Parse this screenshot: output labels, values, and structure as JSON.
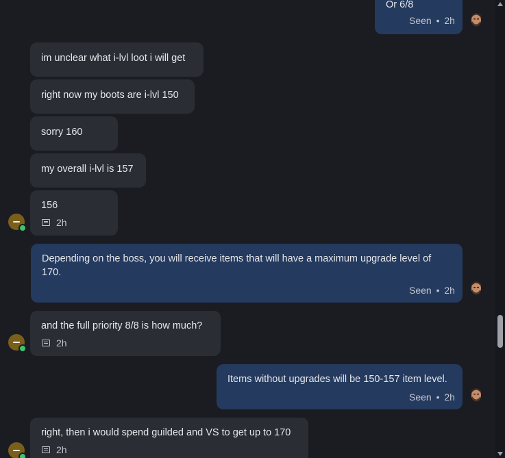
{
  "messages": [
    {
      "text": "Or 6/8",
      "seen": "Seen",
      "time": "2h"
    },
    {
      "text": "im unclear what i-lvl loot i will get"
    },
    {
      "text": "right now my boots are i-lvl 150"
    },
    {
      "text": "sorry 160"
    },
    {
      "text": "my overall i-lvl is 157"
    },
    {
      "text": "156",
      "time": "2h"
    },
    {
      "line1": "Depending on the boss, you will receive items that will have a maximum upgrade level of",
      "line2": "170.",
      "seen": "Seen",
      "time": "2h"
    },
    {
      "text": "and the full priority 8/8 is how much?",
      "time": "2h"
    },
    {
      "text": "Items without upgrades will be 150-157 item level.",
      "seen": "Seen",
      "time": "2h"
    },
    {
      "text": "right, then i would spend guilded and VS to get up to 170",
      "time": "2h"
    }
  ],
  "separator": "•",
  "colors": {
    "background": "#1b1c22",
    "incoming_bubble": "#2b2d34",
    "outgoing_bubble": "#243a5e",
    "online": "#3ec46d",
    "user_avatar": "#7a5f1a"
  },
  "icons": [
    "ticket-icon",
    "user-avatar",
    "agent-avatar",
    "online-status-icon"
  ]
}
